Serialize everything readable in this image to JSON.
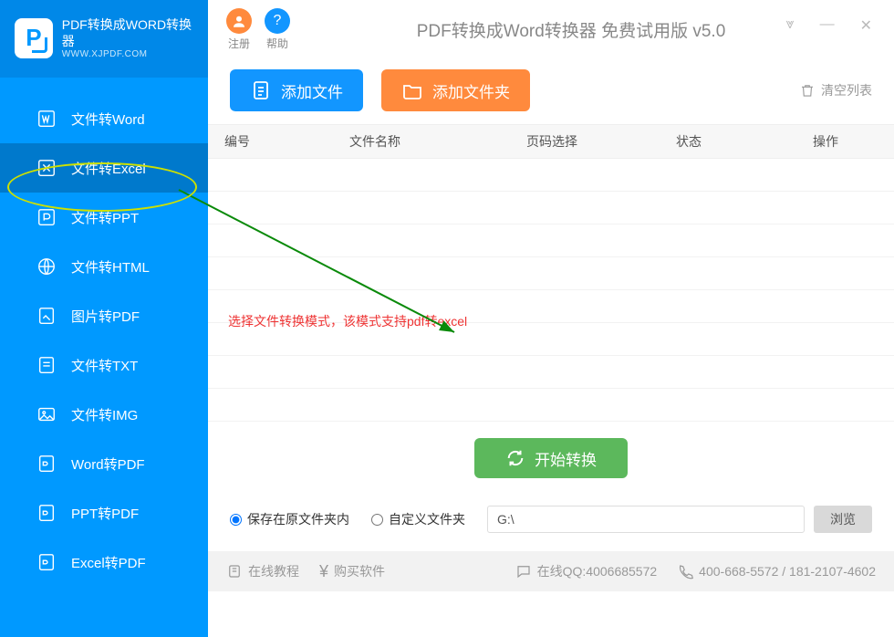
{
  "logo": {
    "title": "PDF转换成WORD转换器",
    "sub": "WWW.XJPDF.COM"
  },
  "sidebar": {
    "items": [
      {
        "label": "文件转Word"
      },
      {
        "label": "文件转Excel"
      },
      {
        "label": "文件转PPT"
      },
      {
        "label": "文件转HTML"
      },
      {
        "label": "图片转PDF"
      },
      {
        "label": "文件转TXT"
      },
      {
        "label": "文件转IMG"
      },
      {
        "label": "Word转PDF"
      },
      {
        "label": "PPT转PDF"
      },
      {
        "label": "Excel转PDF"
      }
    ],
    "activeIndex": 1
  },
  "titlebar": {
    "register": "注册",
    "help": "帮助",
    "title": "PDF转换成Word转换器 免费试用版 v5.0"
  },
  "toolbar": {
    "add_file": "添加文件",
    "add_folder": "添加文件夹",
    "clear_list": "清空列表"
  },
  "table": {
    "headers": {
      "c1": "编号",
      "c2": "文件名称",
      "c3": "页码选择",
      "c4": "状态",
      "c5": "操作"
    }
  },
  "hint": "选择文件转换模式，该模式支持pdf转excel",
  "convert": {
    "start": "开始转换"
  },
  "save": {
    "opt1": "保存在原文件夹内",
    "opt2": "自定义文件夹",
    "path": "G:\\",
    "browse": "浏览"
  },
  "footer": {
    "tutorial": "在线教程",
    "buy": "购买软件",
    "qq_label": "在线QQ:4006685572",
    "phone": "400-668-5572 / 181-2107-4602"
  }
}
